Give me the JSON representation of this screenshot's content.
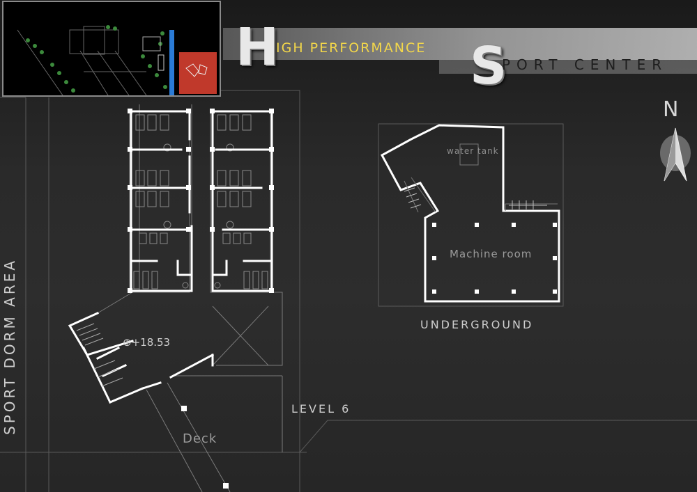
{
  "title": {
    "initial_h": "H",
    "line1": "IGH PERFORMANCE",
    "initial_s": "S",
    "line2": "PORT CENTER"
  },
  "labels": {
    "water_tank": "water tank",
    "machine_room": "Machine room",
    "underground": "UNDERGROUND",
    "level": "LEVEL 6",
    "elevation": "+18.53",
    "deck": "Deck",
    "side_area": "SPORT DORM AREA"
  },
  "compass": {
    "letter": "N"
  },
  "colors": {
    "accent": "#f3d74a",
    "line": "#ffffff",
    "site_red": "#c0392b",
    "site_blue": "#2b7bd6"
  }
}
